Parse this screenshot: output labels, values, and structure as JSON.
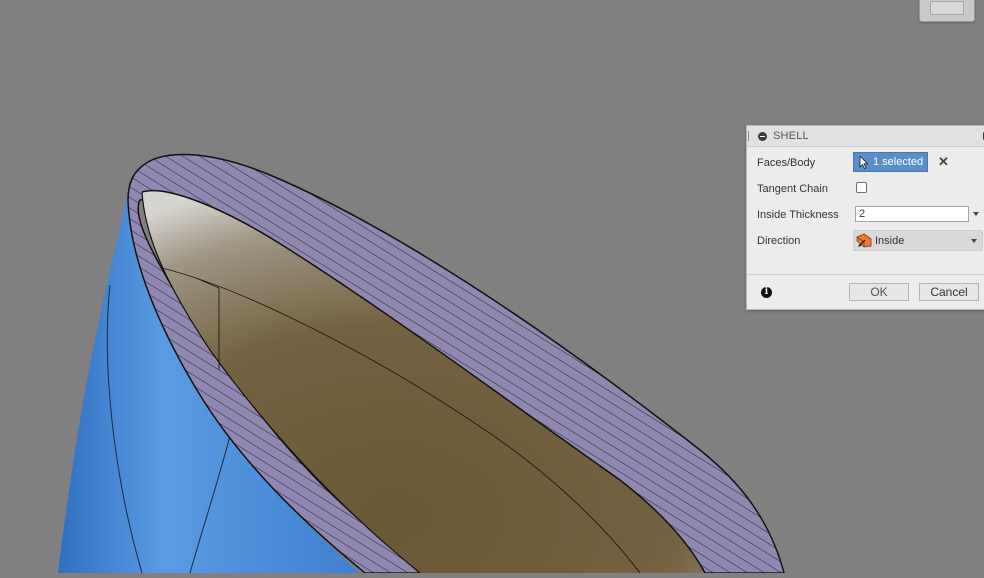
{
  "dialog": {
    "title": "SHELL",
    "rows": {
      "faces_body": {
        "label": "Faces/Body",
        "selection": "1 selected"
      },
      "tangent_chain": {
        "label": "Tangent Chain",
        "checked": false
      },
      "inside_thickness": {
        "label": "Inside Thickness",
        "value": "2"
      },
      "direction": {
        "label": "Direction",
        "value": "Inside"
      }
    },
    "buttons": {
      "ok": "OK",
      "cancel": "Cancel"
    },
    "clear_glyph": "✕",
    "info_glyph": "i"
  },
  "viewport": {
    "body_color": "#4e8fd6",
    "section_hatch_color": "#8f86ad",
    "inner_face_color": "#6f5c3c",
    "background_color": "#808080"
  },
  "icons": [
    "collapse-icon",
    "cursor-icon",
    "clear-icon",
    "direction-icon",
    "info-icon",
    "dropdown-arrow-icon"
  ]
}
